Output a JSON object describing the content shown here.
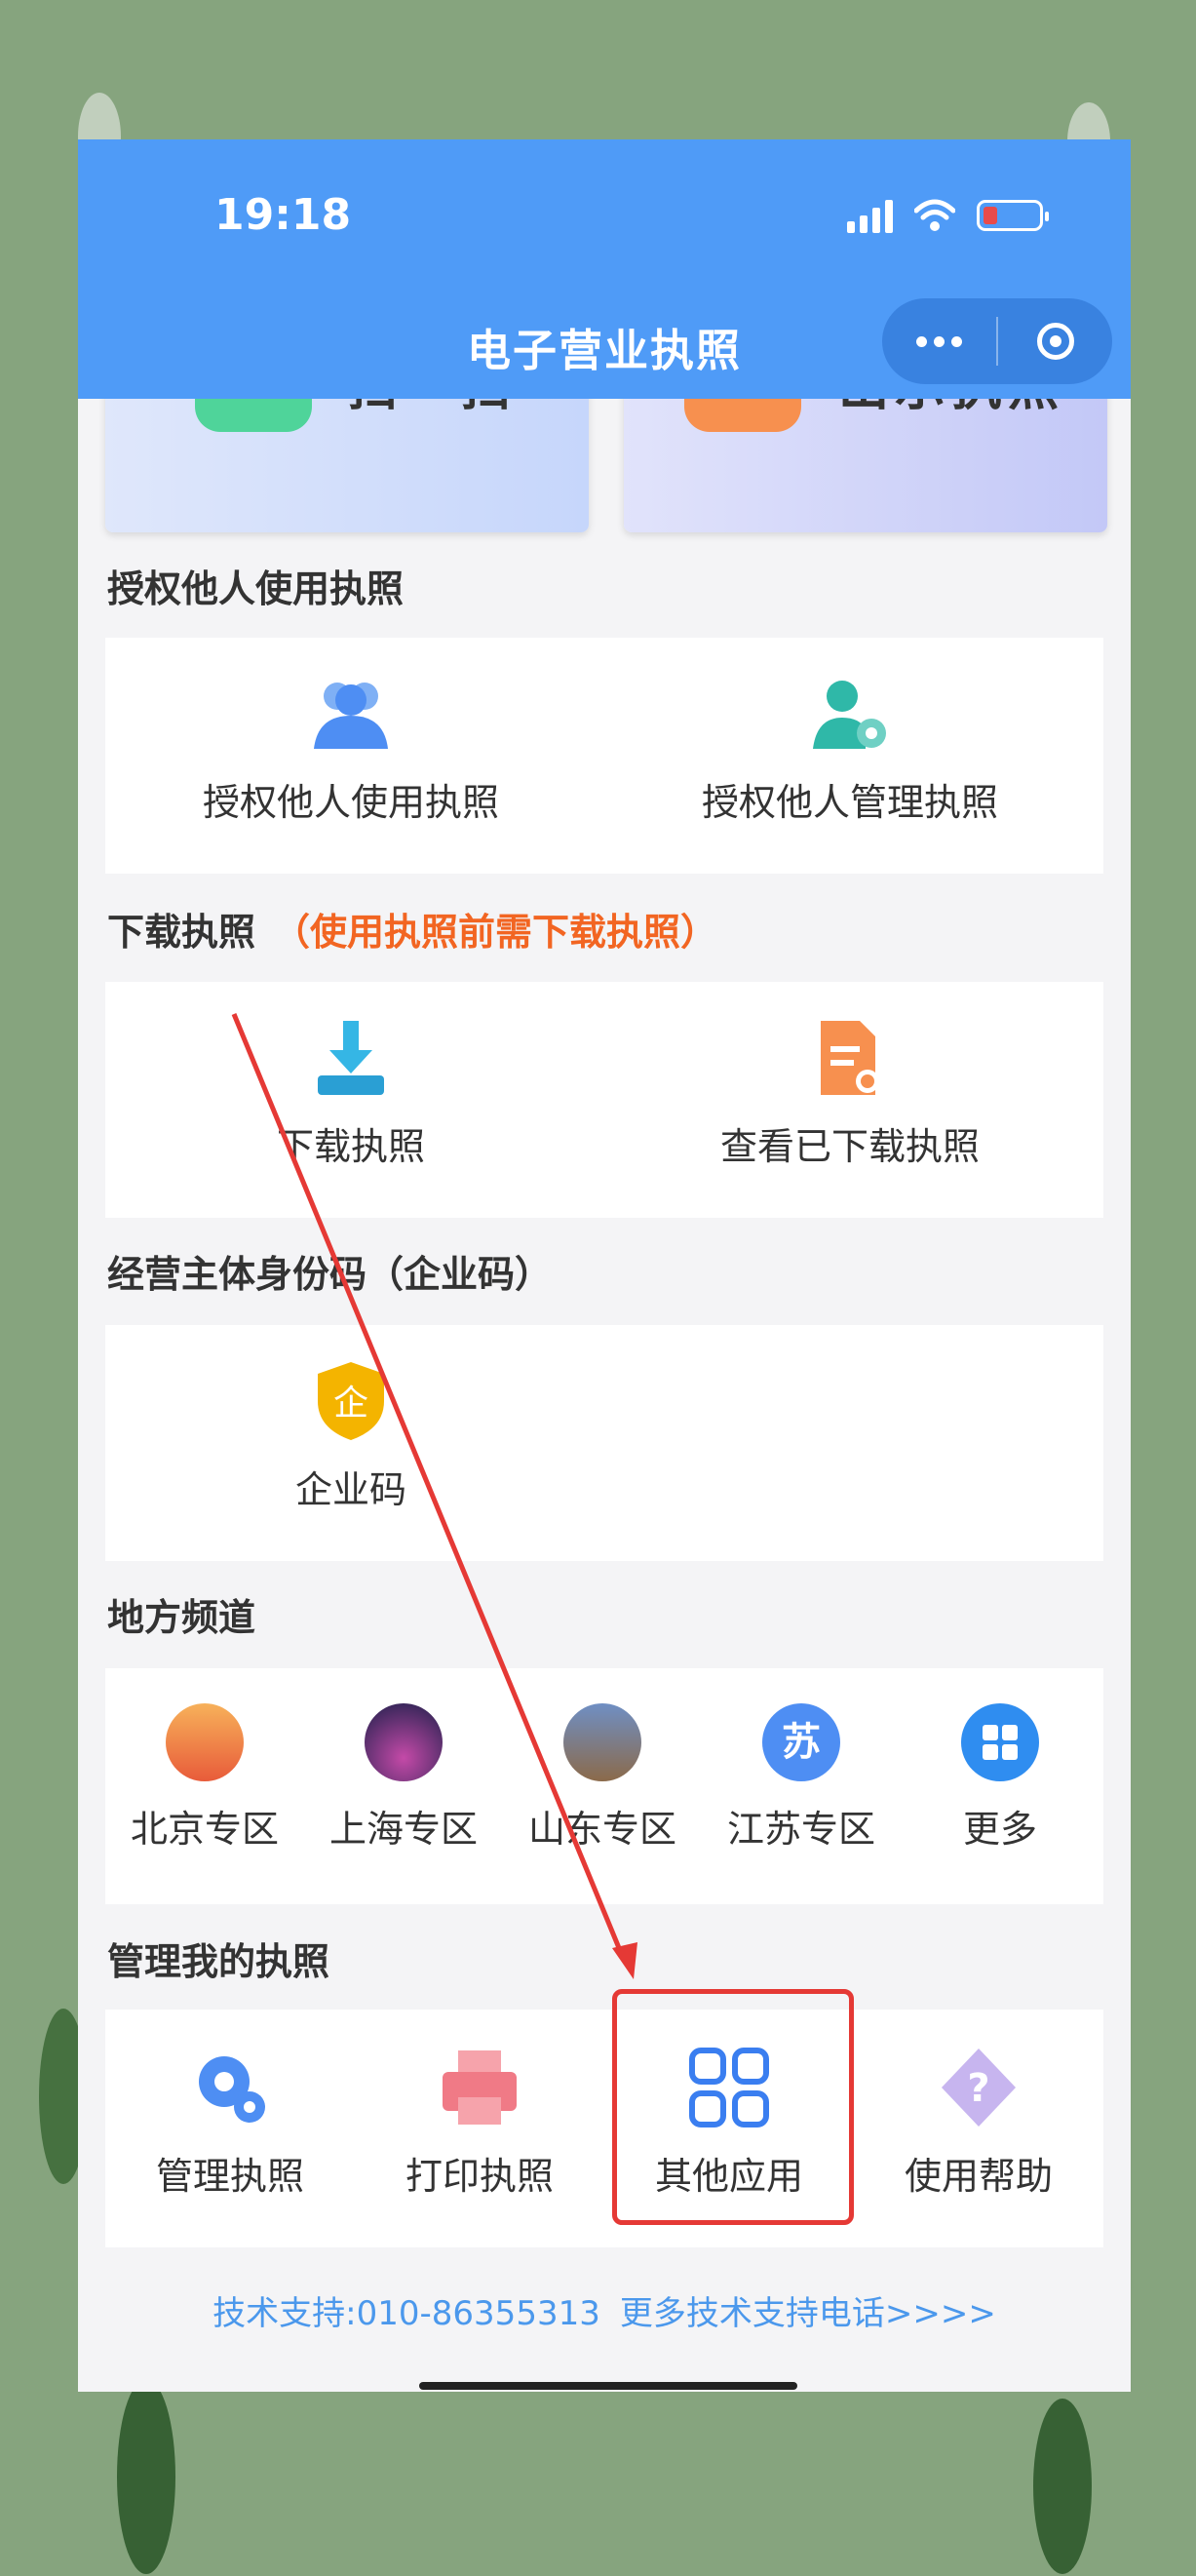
{
  "status_bar": {
    "time": "19:18"
  },
  "header": {
    "title": "电子营业执照"
  },
  "top_cards": {
    "scan": "扫一扫",
    "show": "出示执照"
  },
  "sections": {
    "authorize": {
      "title": "授权他人使用执照",
      "items": [
        "授权他人使用执照",
        "授权他人管理执照"
      ]
    },
    "download": {
      "title": "下载执照",
      "note": "（使用执照前需下载执照）",
      "items": [
        "下载执照",
        "查看已下载执照"
      ]
    },
    "identity": {
      "title": "经营主体身份码（企业码）",
      "items": [
        "企业码"
      ],
      "icon_char": "企"
    },
    "local": {
      "title": "地方频道",
      "items": [
        "北京专区",
        "上海专区",
        "山东专区",
        "江苏专区",
        "更多"
      ],
      "su_char": "苏"
    },
    "manage": {
      "title": "管理我的执照",
      "items": [
        "管理执照",
        "打印执照",
        "其他应用",
        "使用帮助"
      ]
    }
  },
  "footer": {
    "support": "技术支持:010-86355313",
    "more": "更多技术支持电话>>>>"
  },
  "colors": {
    "header": "#4f9bf7",
    "warning": "#f26522",
    "link": "#4b98ec",
    "highlight": "#e53935"
  }
}
